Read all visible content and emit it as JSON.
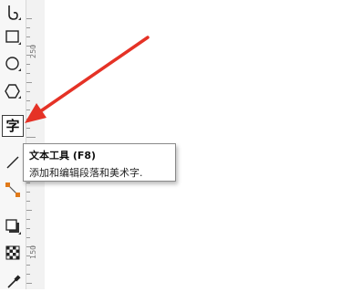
{
  "toolbox": {
    "tools": [
      {
        "icon": "freehand-curve-icon"
      },
      {
        "icon": "rectangle-tool-icon"
      },
      {
        "icon": "ellipse-tool-icon"
      },
      {
        "icon": "polygon-tool-icon"
      },
      {
        "icon": "text-tool-icon",
        "glyph": "字",
        "active": true
      },
      {
        "icon": "line-connector-icon"
      },
      {
        "icon": "dimension-tool-icon"
      },
      {
        "icon": "drop-shadow-icon"
      },
      {
        "icon": "transparency-icon"
      },
      {
        "icon": "eyedropper-icon"
      }
    ]
  },
  "ruler": {
    "labels": [
      "250",
      "150"
    ]
  },
  "tooltip": {
    "title": "文本工具 (F8)",
    "description": "添加和编辑段落和美术字."
  },
  "colors": {
    "arrow": "#e53226"
  }
}
